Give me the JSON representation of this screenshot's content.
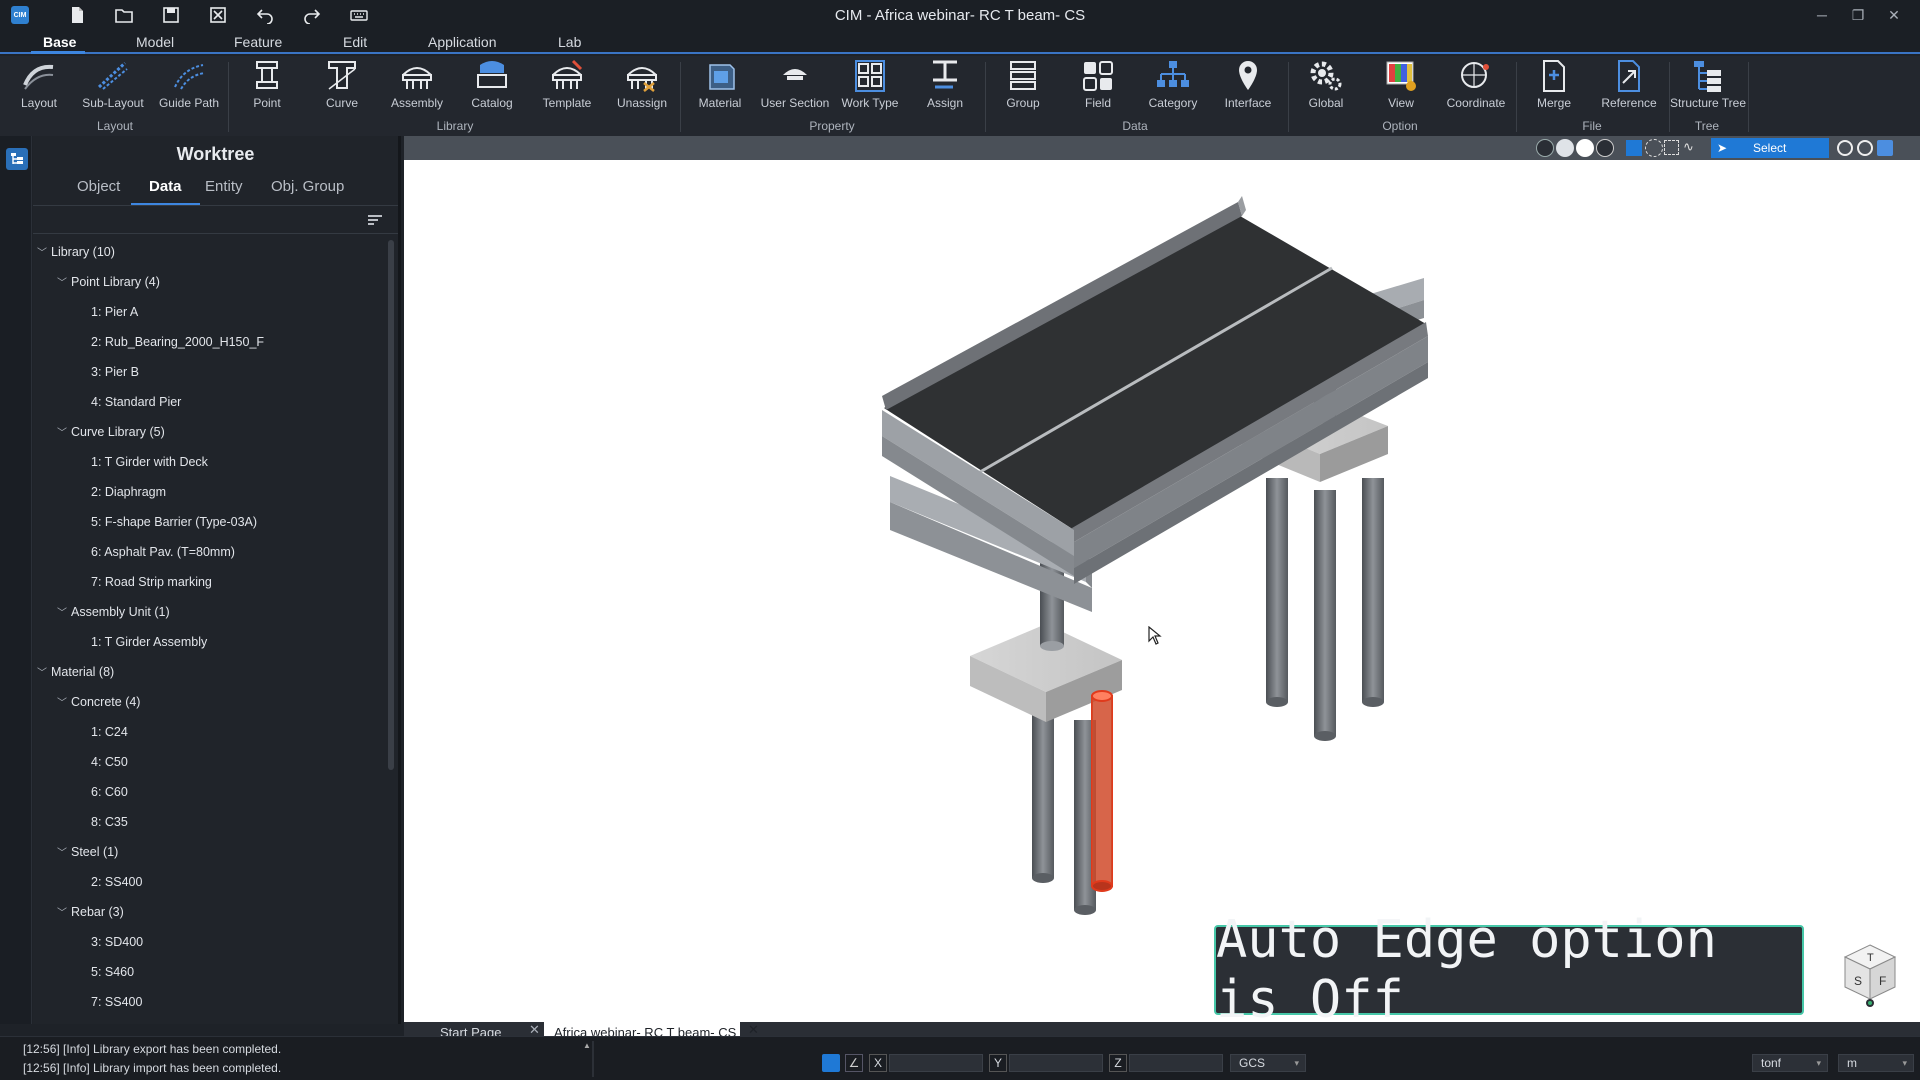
{
  "window": {
    "title": "CIM - Africa webinar- RC T beam- CS",
    "logo": "CIM"
  },
  "menu": {
    "tabs": [
      "Base",
      "Model",
      "Feature",
      "Edit",
      "Application",
      "Lab"
    ]
  },
  "ribbon": {
    "buttons": [
      {
        "label": "Layout",
        "icon": "layout-icon"
      },
      {
        "label": "Sub-Layout",
        "icon": "sub-layout-icon"
      },
      {
        "label": "Guide Path",
        "icon": "guide-path-icon"
      },
      {
        "label": "Point",
        "icon": "point-icon"
      },
      {
        "label": "Curve",
        "icon": "curve-icon"
      },
      {
        "label": "Assembly",
        "icon": "assembly-icon"
      },
      {
        "label": "Catalog",
        "icon": "catalog-icon"
      },
      {
        "label": "Template",
        "icon": "template-icon"
      },
      {
        "label": "Unassign",
        "icon": "unassign-icon"
      },
      {
        "label": "Material",
        "icon": "material-icon"
      },
      {
        "label": "User Section",
        "icon": "user-section-icon"
      },
      {
        "label": "Work Type",
        "icon": "work-type-icon"
      },
      {
        "label": "Assign",
        "icon": "assign-icon"
      },
      {
        "label": "Group",
        "icon": "group-icon"
      },
      {
        "label": "Field",
        "icon": "field-icon"
      },
      {
        "label": "Category",
        "icon": "category-icon"
      },
      {
        "label": "Interface",
        "icon": "interface-icon"
      },
      {
        "label": "Global",
        "icon": "global-icon"
      },
      {
        "label": "View",
        "icon": "view-icon"
      },
      {
        "label": "Coordinate",
        "icon": "coordinate-icon"
      },
      {
        "label": "Merge",
        "icon": "merge-icon"
      },
      {
        "label": "Reference",
        "icon": "reference-icon"
      },
      {
        "label": "Structure Tree",
        "icon": "structure-tree-icon"
      }
    ],
    "groups": [
      "Layout",
      "Library",
      "Property",
      "Data",
      "Option",
      "File",
      "Tree"
    ]
  },
  "worktree": {
    "title": "Worktree",
    "tabs": [
      "Object",
      "Data",
      "Entity",
      "Obj. Group"
    ],
    "active_tab": "Data",
    "tree": [
      {
        "label": "Library (10)",
        "level": 0,
        "expanded": true
      },
      {
        "label": "Point Library (4)",
        "level": 1,
        "expanded": true
      },
      {
        "label": "1: Pier A",
        "level": 2
      },
      {
        "label": "2: Rub_Bearing_2000_H150_F",
        "level": 2
      },
      {
        "label": "3: Pier B",
        "level": 2
      },
      {
        "label": "4: Standard Pier",
        "level": 2
      },
      {
        "label": "Curve Library (5)",
        "level": 1,
        "expanded": true
      },
      {
        "label": "1: T Girder with Deck",
        "level": 2
      },
      {
        "label": "2: Diaphragm",
        "level": 2
      },
      {
        "label": "5: F-shape Barrier (Type-03A)",
        "level": 2
      },
      {
        "label": "6: Asphalt Pav. (T=80mm)",
        "level": 2
      },
      {
        "label": "7: Road Strip marking",
        "level": 2
      },
      {
        "label": "Assembly Unit (1)",
        "level": 1,
        "expanded": true
      },
      {
        "label": "1: T Girder Assembly",
        "level": 2
      },
      {
        "label": "Material (8)",
        "level": 0,
        "expanded": true
      },
      {
        "label": "Concrete (4)",
        "level": 1,
        "expanded": true
      },
      {
        "label": "1: C24",
        "level": 2
      },
      {
        "label": "4: C50",
        "level": 2
      },
      {
        "label": "6: C60",
        "level": 2
      },
      {
        "label": "8: C35",
        "level": 2
      },
      {
        "label": "Steel (1)",
        "level": 1,
        "expanded": true
      },
      {
        "label": "2: SS400",
        "level": 2
      },
      {
        "label": "Rebar (3)",
        "level": 1,
        "expanded": true
      },
      {
        "label": "3: SD400",
        "level": 2
      },
      {
        "label": "5: S460",
        "level": 2
      },
      {
        "label": "7: SS400",
        "level": 2
      }
    ]
  },
  "viewport": {
    "select_label": "Select",
    "banner": "Auto Edge option is Off",
    "navcube_faces": [
      "T",
      "S",
      "F"
    ],
    "highlight_color": "#e03a1c"
  },
  "doc_tabs": [
    "Start Page",
    "Africa webinar- RC T beam- CS"
  ],
  "status": {
    "log": [
      "[12:56] [Info] Library export has been completed.",
      "[12:56] [Info] Library import has been completed."
    ],
    "coord_labels": [
      "X",
      "Y",
      "Z"
    ],
    "coord_system": "GCS",
    "force_unit": "tonf",
    "length_unit": "m"
  },
  "colors": {
    "accent": "#3d86e0",
    "select_button": "#1f79d6",
    "banner_border": "#46c7a8"
  }
}
